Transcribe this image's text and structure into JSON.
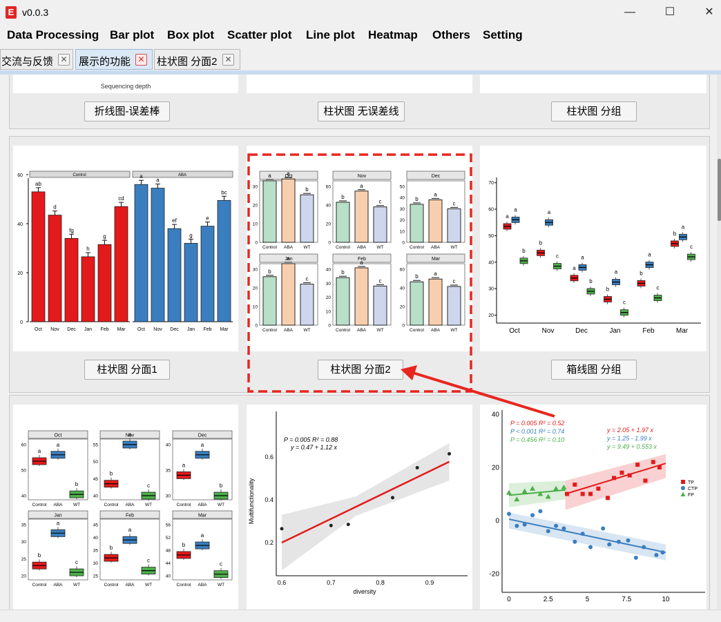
{
  "app": {
    "icon_letter": "E",
    "title": "v0.0.3"
  },
  "window_controls": {
    "minimize": "—",
    "maximize": "☐",
    "close": "✕"
  },
  "menu": [
    "Data Processing",
    "Bar plot",
    "Box plot",
    "Scatter plot",
    "Line plot",
    "Heatmap",
    "Others",
    "Setting"
  ],
  "tabs": [
    {
      "label": "交流与反馈",
      "active": false
    },
    {
      "label": "展示的功能",
      "active": true
    },
    {
      "label": "柱状图 分面2",
      "active": false
    }
  ],
  "row1": {
    "caption": "Sequencing depth",
    "buttons": [
      "折线图-误差棒",
      "柱状图 无误差线",
      "柱状图 分组"
    ]
  },
  "row2": {
    "buttons": [
      "柱状图 分面1",
      "柱状图 分面2",
      "箱线图 分组"
    ],
    "facet1": {
      "panels": [
        "Control",
        "ABA"
      ],
      "yticks": [
        "0",
        "20",
        "40",
        "60"
      ],
      "months": [
        "Oct",
        "Nov",
        "Dec",
        "Jan",
        "Feb",
        "Mar"
      ],
      "control_values": [
        53,
        43.5,
        34,
        26.5,
        31.5,
        47
      ],
      "control_letters": [
        "ab",
        "d",
        "fg",
        "h",
        "g",
        "cd"
      ],
      "aba_values": [
        56,
        54.5,
        38,
        32,
        39,
        49.5
      ],
      "aba_letters": [
        "a",
        "a",
        "ef",
        "g",
        "e",
        "bc"
      ]
    },
    "facet2": {
      "treatments": [
        "Control",
        "ABA",
        "WT"
      ],
      "panels": [
        {
          "title": "Oct",
          "yticks": [
            "0",
            "10",
            "20",
            "30"
          ],
          "values": [
            33,
            34,
            25.5
          ],
          "letters": [
            "a",
            "a",
            "b"
          ]
        },
        {
          "title": "Nov",
          "yticks": [
            "0",
            "20",
            "40",
            "60"
          ],
          "values": [
            43,
            55,
            38
          ],
          "letters": [
            "b",
            "a",
            "c"
          ]
        },
        {
          "title": "Dec",
          "yticks": [
            "0",
            "10",
            "20",
            "30",
            "40",
            "50"
          ],
          "values": [
            34,
            38,
            30
          ],
          "letters": [
            "b",
            "a",
            "c"
          ]
        },
        {
          "title": "Jan",
          "yticks": [
            "0",
            "10",
            "20",
            "30"
          ],
          "values": [
            26,
            33,
            22
          ],
          "letters": [
            "b",
            "a",
            "c"
          ]
        },
        {
          "title": "Feb",
          "yticks": [
            "0",
            "10",
            "20",
            "30",
            "40"
          ],
          "values": [
            34,
            41,
            28
          ],
          "letters": [
            "b",
            "a",
            "c"
          ]
        },
        {
          "title": "Mar",
          "yticks": [
            "0",
            "20",
            "40",
            "60"
          ],
          "values": [
            46.5,
            49.5,
            41.5
          ],
          "letters": [
            "b",
            "a",
            "c"
          ]
        }
      ]
    },
    "boxgroup": {
      "yticks": [
        "20",
        "30",
        "40",
        "50",
        "60",
        "70"
      ],
      "months": [
        "Oct",
        "Nov",
        "Dec",
        "Jan",
        "Feb",
        "Mar"
      ],
      "medians": [
        [
          53.5,
          56,
          40.5
        ],
        [
          43.5,
          55,
          38.5
        ],
        [
          34,
          38,
          29
        ],
        [
          26,
          32.5,
          21
        ],
        [
          32,
          39,
          26.5
        ],
        [
          47,
          49.5,
          42
        ]
      ],
      "letters": [
        [
          "a",
          "a",
          "b"
        ],
        [
          "b",
          "a",
          "c"
        ],
        [
          "a",
          "a",
          "b"
        ],
        [
          "b",
          "a",
          "c"
        ],
        [
          "b",
          "a",
          "c"
        ],
        [
          "b",
          "a",
          "c"
        ]
      ]
    }
  },
  "row3": {
    "box_facet": {
      "treatments": [
        "Control",
        "ABA",
        "WT"
      ],
      "panels": [
        {
          "title": "Oct",
          "yticks": [
            "40",
            "50",
            "60"
          ],
          "medians": [
            53.5,
            56,
            40.5
          ],
          "letters": [
            "a",
            "a",
            "b"
          ]
        },
        {
          "title": "Nov",
          "yticks": [
            "40",
            "45",
            "50",
            "55"
          ],
          "medians": [
            43.5,
            55,
            38.5
          ],
          "letters": [
            "b",
            "a",
            "c"
          ]
        },
        {
          "title": "Dec",
          "yticks": [
            "30",
            "35",
            "40"
          ],
          "medians": [
            34,
            38,
            29
          ],
          "letters": [
            "a",
            "a",
            "b"
          ]
        },
        {
          "title": "Jan",
          "yticks": [
            "20",
            "25",
            "30",
            "35"
          ],
          "medians": [
            23,
            32.5,
            21
          ],
          "letters": [
            "b",
            "a",
            "c"
          ]
        },
        {
          "title": "Feb",
          "yticks": [
            "25",
            "30",
            "35",
            "40",
            "45"
          ],
          "medians": [
            32,
            39,
            27
          ],
          "letters": [
            "b",
            "a",
            "c"
          ]
        },
        {
          "title": "Mar",
          "yticks": [
            "40",
            "44",
            "48",
            "52",
            "56"
          ],
          "medians": [
            46.5,
            49.5,
            40.5
          ],
          "letters": [
            "b",
            "a",
            "c"
          ]
        }
      ]
    },
    "regression": {
      "stat1": "P = 0.005   R² = 0.88",
      "stat2": "y =   0.47 + 1.12 x",
      "ylabel": "Multifunctionality",
      "xlabel": "diversity",
      "xticks": [
        "0.6",
        "0.7",
        "0.8",
        "0.9"
      ],
      "yticks": [
        "0.2",
        "0.4",
        "0.6"
      ],
      "points_x": [
        0.6,
        0.7,
        0.735,
        0.825,
        0.875,
        0.94
      ],
      "points_y": [
        0.265,
        0.28,
        0.285,
        0.41,
        0.55,
        0.615
      ]
    },
    "multi_regression": {
      "p_labels": [
        "P = 0.005   R² = 0.52",
        "P < 0.001   R² = 0.74",
        "P = 0.456   R² = 0.10"
      ],
      "eq_labels": [
        "y = 2.05 + 1.97 x",
        "y = 1.25 - 1.99 x",
        "y = 9.49 + 0.553 x"
      ],
      "legend": [
        "TP",
        "CTP",
        "FP"
      ],
      "colors": [
        "#e31a1c",
        "#3a7ebf",
        "#4daf4a"
      ],
      "xticks": [
        "0",
        "2.5",
        "5",
        "7.5",
        "10"
      ],
      "yticks": [
        "-20",
        "0",
        "20",
        "40"
      ]
    }
  }
}
